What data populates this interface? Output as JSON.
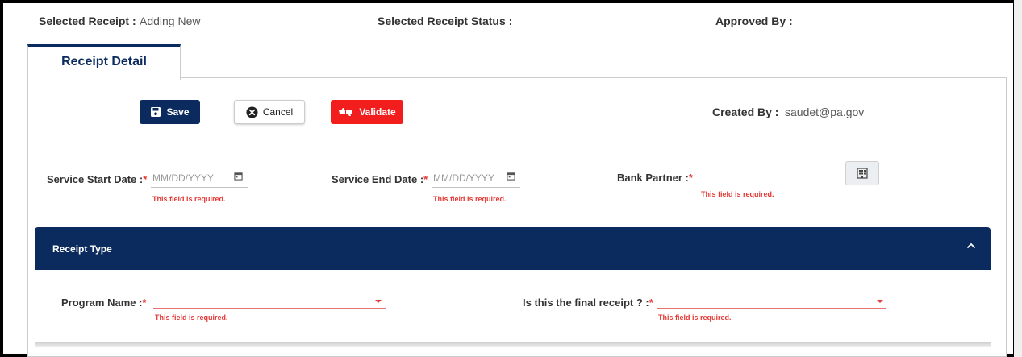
{
  "header": {
    "selected_receipt_label": "Selected Receipt :",
    "selected_receipt_value": "Adding New",
    "status_label": "Selected Receipt Status :",
    "approved_by_label": "Approved By :"
  },
  "tabs": [
    {
      "label": "Receipt Detail",
      "active": true
    }
  ],
  "toolbar": {
    "save_label": "Save",
    "cancel_label": "Cancel",
    "validate_label": "Validate",
    "created_by_label": "Created By :",
    "created_by_value": "saudet@pa.gov"
  },
  "dates": {
    "start_label": "Service Start Date :",
    "start_placeholder": "MM/DD/YYYY",
    "end_label": "Service End Date :",
    "end_placeholder": "MM/DD/YYYY",
    "bank_label": "Bank Partner :",
    "required_marker": "*",
    "error_text": "This field is required."
  },
  "receipt_type": {
    "title": "Receipt Type",
    "program_label": "Program Name :",
    "final_label": "Is this the final receipt ? :"
  },
  "colors": {
    "primary": "#0b2b5e",
    "danger": "#f21d1d",
    "error": "#e53935"
  }
}
